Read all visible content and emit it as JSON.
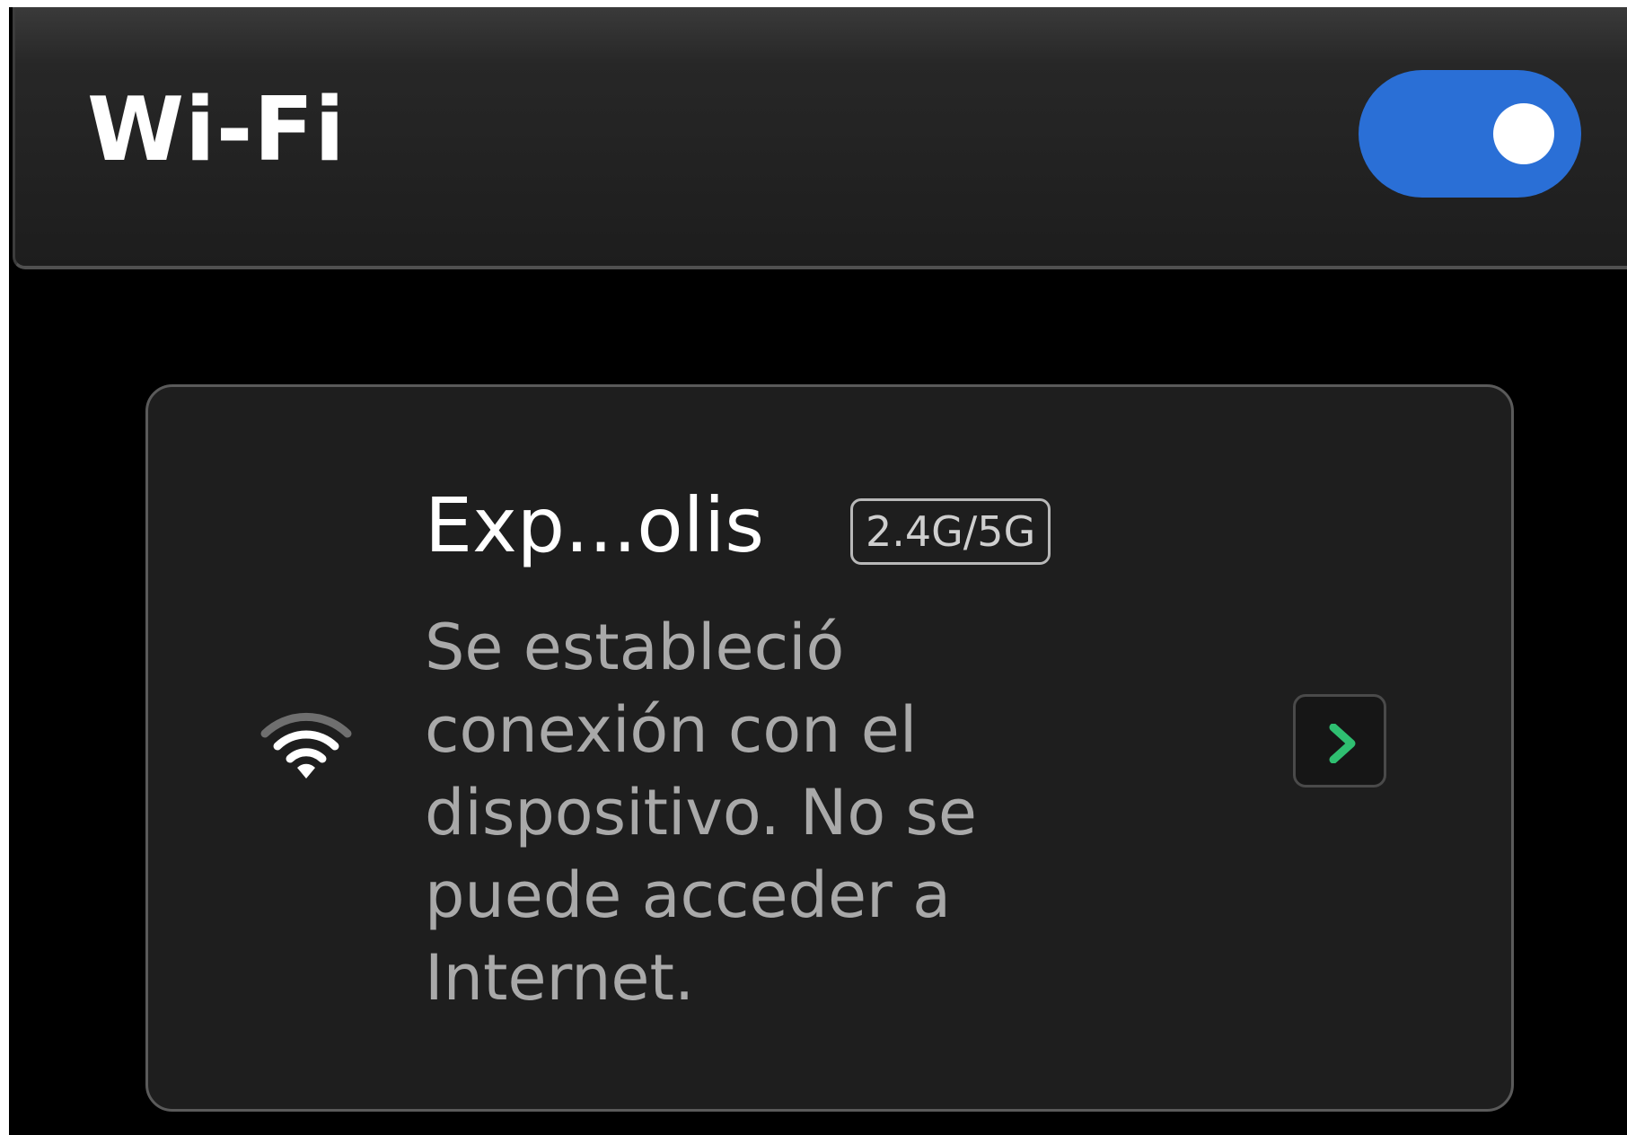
{
  "header": {
    "title": "Wi-Fi",
    "wifi_enabled": true
  },
  "network": {
    "name": "Exp...olis",
    "band": "2.4G/5G",
    "status": "Se estableció conexión con el dispositivo. No se puede acceder a Internet.",
    "signal_icon": "wifi-signal-icon",
    "detail_icon": "chevron-right-icon"
  },
  "colors": {
    "toggle_on": "#2a6fd6",
    "chevron": "#2fbf71",
    "background": "#000000",
    "card": "#1e1e1e"
  }
}
